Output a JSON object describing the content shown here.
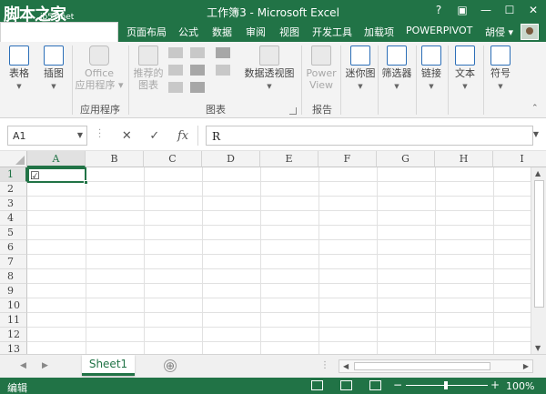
{
  "window": {
    "title": "工作簿3 - Microsoft Excel",
    "watermark": "脚本之家",
    "watermark_sub": "jb51.net",
    "controls": [
      "?",
      "▣",
      "—",
      "☐",
      "✕"
    ]
  },
  "tabs": [
    {
      "label": "页面布局",
      "active": false
    },
    {
      "label": "公式",
      "active": false
    },
    {
      "label": "数据",
      "active": false
    },
    {
      "label": "审阅",
      "active": false
    },
    {
      "label": "视图",
      "active": false
    },
    {
      "label": "开发工具",
      "active": false
    },
    {
      "label": "加载项",
      "active": false
    },
    {
      "label": "POWERPIVOT",
      "active": false
    }
  ],
  "user": {
    "name": "胡侵 ▾"
  },
  "ribbon": {
    "buttons": {
      "table": "表格",
      "illustrations": "插图",
      "office_line1": "Office",
      "office_line2": "应用程序 ▾",
      "recommended_line1": "推荐的",
      "recommended_line2": "图表",
      "pivotchart": "数据透视图",
      "power_line1": "Power",
      "power_line2": "View",
      "sparklines": "迷你图",
      "filters": "筛选器",
      "links": "链接",
      "text": "文本",
      "symbols": "符号"
    },
    "groups": {
      "apps": "应用程序",
      "charts": "图表",
      "reports": "报告"
    },
    "colors": {
      "accent": "#217346",
      "icon_blue": "#2c6fb8"
    }
  },
  "formula_bar": {
    "name_box": "A1",
    "cancel": "✕",
    "enter": "✓",
    "fx": "fx",
    "value": "R"
  },
  "columns": [
    "A",
    "B",
    "C",
    "D",
    "E",
    "F",
    "G",
    "H",
    "I"
  ],
  "rows": [
    "1",
    "2",
    "3",
    "4",
    "5",
    "6",
    "7",
    "8",
    "9",
    "10",
    "11",
    "12",
    "13"
  ],
  "active_cell": {
    "ref": "A1",
    "display": "☑"
  },
  "sheets": [
    {
      "name": "Sheet1",
      "active": true
    }
  ],
  "add_sheet": "⊕",
  "status": {
    "mode": "编辑",
    "zoom_minus": "−",
    "zoom_plus": "+",
    "zoom": "100%"
  }
}
